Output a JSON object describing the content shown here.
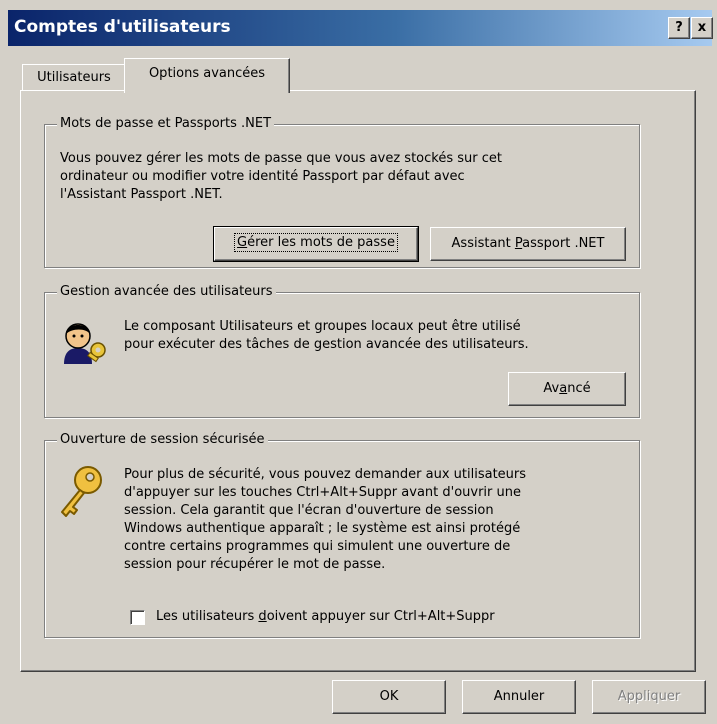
{
  "window": {
    "title": "Comptes d'utilisateurs",
    "help_label": "?",
    "close_label": "x"
  },
  "tabs": [
    {
      "label": "Utilisateurs",
      "selected": false
    },
    {
      "label": "Options avancées",
      "selected": true
    }
  ],
  "passwords_group": {
    "legend": "Mots de passe et Passports .NET",
    "lines": [
      "Vous pouvez gérer les mots de passe que vous avez stockés sur cet",
      "ordinateur ou modifier votre identité Passport par défaut avec",
      "l'Assistant Passport .NET."
    ],
    "manage_button": {
      "pre": "",
      "mnemonic": "G",
      "post": "érer les mots de passe"
    },
    "wizard_button": {
      "pre": "Assistant ",
      "mnemonic": "P",
      "post": "assport .NET"
    }
  },
  "advanced_group": {
    "legend": "Gestion avancée des utilisateurs",
    "lines": [
      "Le composant Utilisateurs et groupes locaux peut être utilisé",
      "pour exécuter des tâches de gestion avancée des utilisateurs."
    ],
    "advanced_button": {
      "pre": "Av",
      "mnemonic": "a",
      "post": "ncé"
    },
    "icon": "user-key-icon"
  },
  "secure_logon_group": {
    "legend": "Ouverture de session sécurisée",
    "lines": [
      "Pour plus de sécurité, vous pouvez demander aux utilisateurs",
      "d'appuyer sur les touches Ctrl+Alt+Suppr avant d'ouvrir une",
      "session. Cela garantit que l'écran d'ouverture de session",
      "Windows authentique apparaît ; le système est ainsi protégé",
      "contre certains programmes qui simulent une ouverture de",
      "session pour récupérer le mot de passe."
    ],
    "checkbox": {
      "pre": "Les utilisateurs ",
      "mnemonic": "d",
      "post": "oivent appuyer sur Ctrl+Alt+Suppr",
      "checked": false
    },
    "icon": "key-icon"
  },
  "footer": {
    "ok_label": "OK",
    "cancel_label": "Annuler",
    "apply_label": "Appliquer"
  },
  "colors": {
    "face": "#d4d0c8",
    "title_start": "#0a246a",
    "title_end": "#a6caf0"
  }
}
